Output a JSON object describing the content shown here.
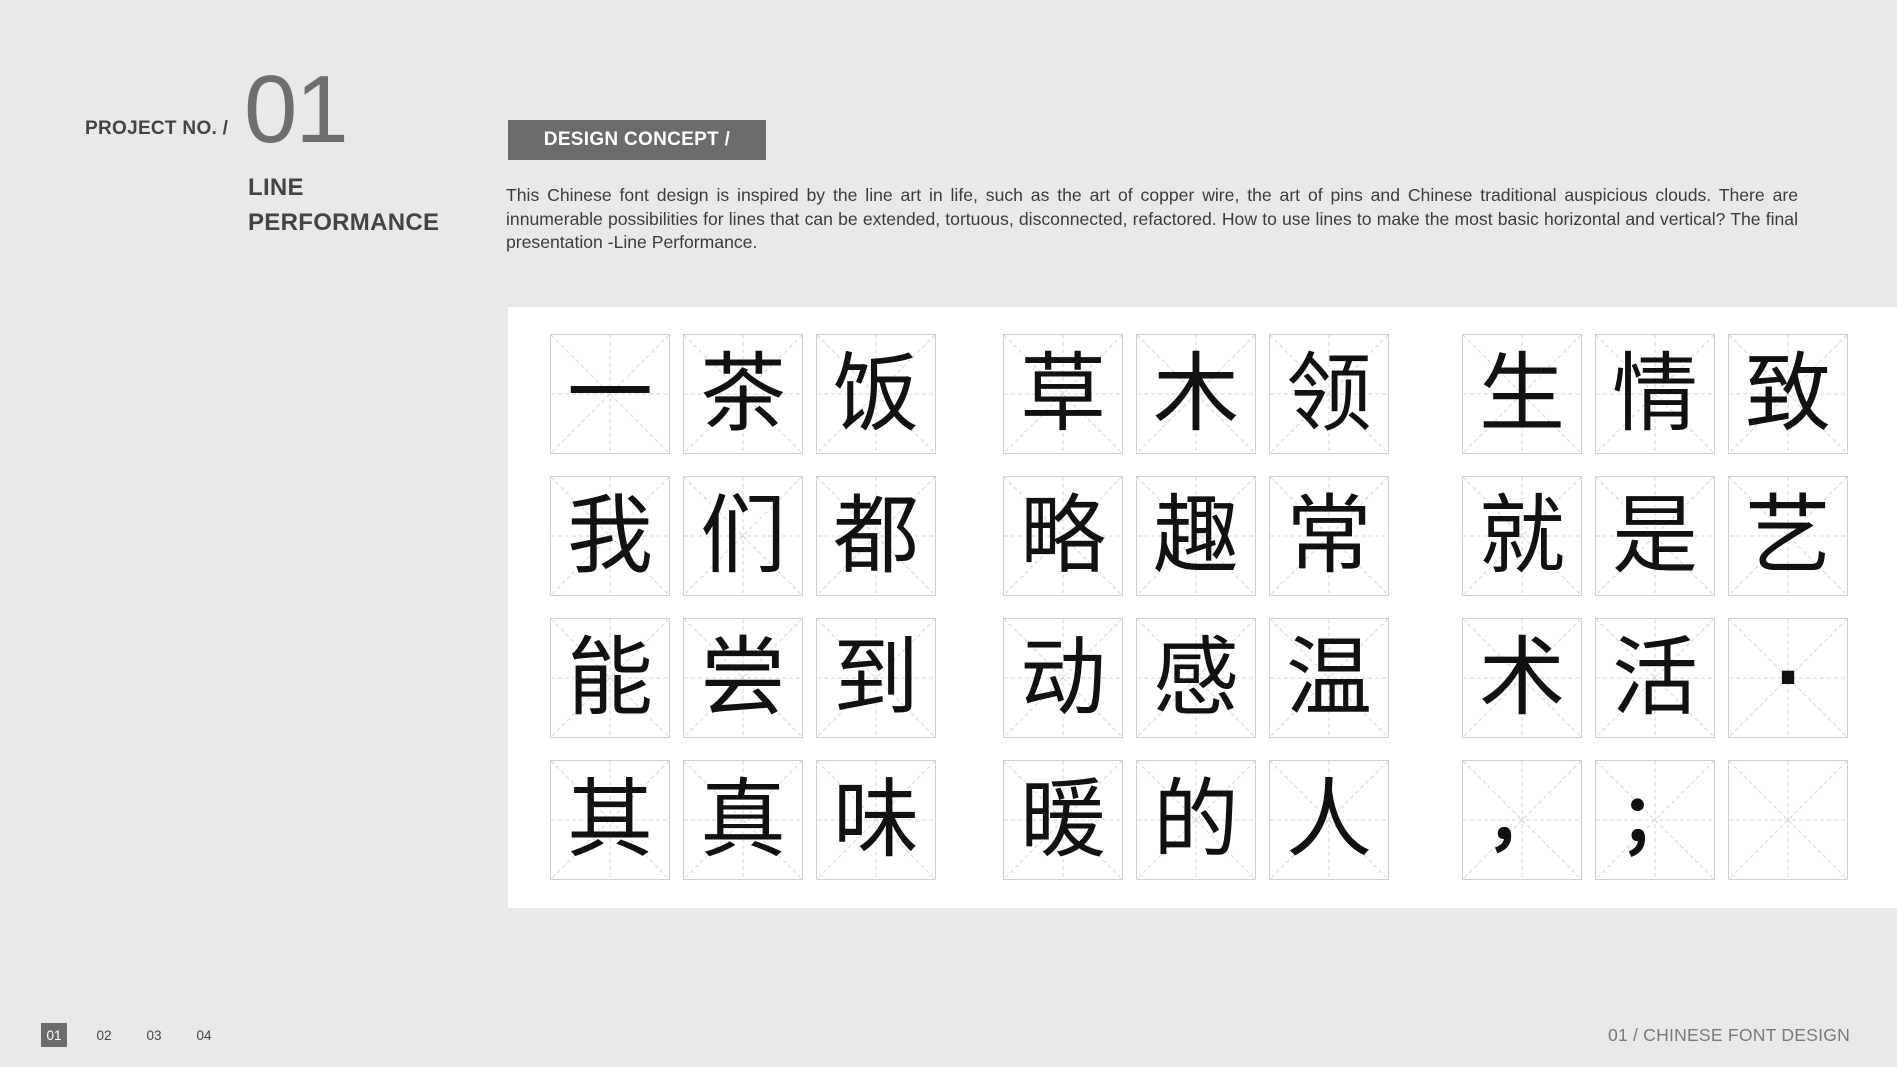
{
  "project": {
    "label": "PROJECT NO. /",
    "number": "01",
    "title_line1": "LINE",
    "title_line2": "PERFORMANCE"
  },
  "concept": {
    "badge": "DESIGN CONCEPT /",
    "text": "This Chinese font design is inspired by the line art in life, such as the art of copper wire, the art of pins and Chinese traditional auspicious clouds. There are innumerable possibilities for lines that can be extended, tortuous, disconnected, refactored. How to use lines to make the most basic horizontal and vertical? The final presentation -Line Performance."
  },
  "glyph_grid": [
    [
      "一",
      "茶",
      "饭",
      "草",
      "木",
      "领",
      "生",
      "情",
      "致"
    ],
    [
      "我",
      "们",
      "都",
      "略",
      "趣",
      "常",
      "就",
      "是",
      "艺"
    ],
    [
      "能",
      "尝",
      "到",
      "动",
      "感",
      "温",
      "术",
      "活",
      "·"
    ],
    [
      "其",
      "真",
      "味",
      "暖",
      "的",
      "人",
      "，",
      "；",
      ""
    ]
  ],
  "pager": {
    "pages": [
      "01",
      "02",
      "03",
      "04"
    ],
    "active": "01"
  },
  "footer": {
    "title": "01 / CHINESE FONT DESIGN"
  },
  "colors": {
    "background": "#e9e9e9",
    "panel": "#ffffff",
    "accent_gray": "#6b6b6b",
    "guide_line": "#cfcfcf"
  }
}
